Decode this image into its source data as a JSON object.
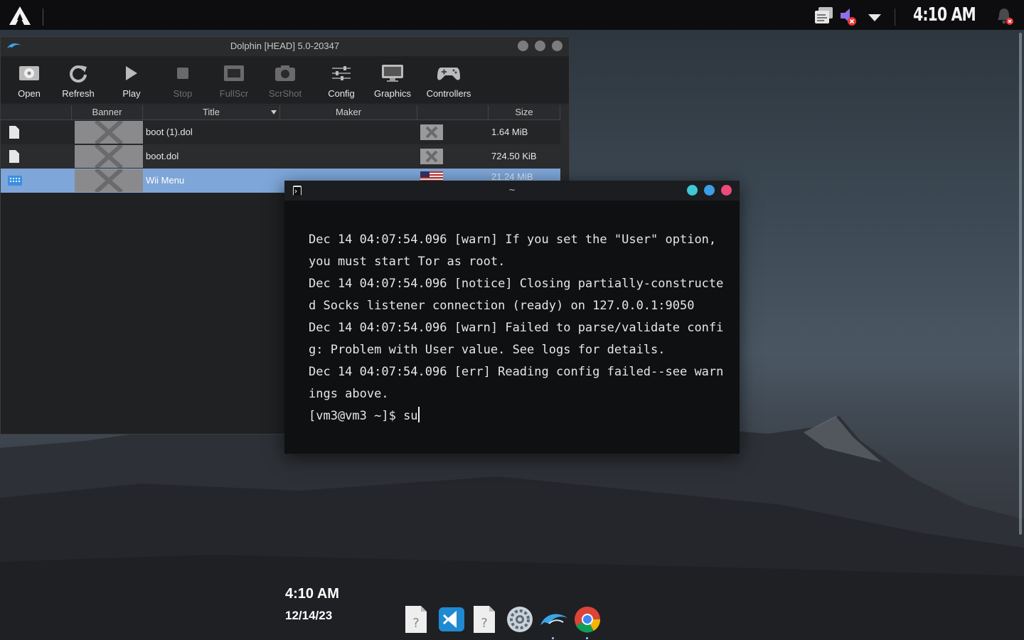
{
  "topbar": {
    "clock": "4:10 AM",
    "tray": [
      "clipboard-icon",
      "volume-muted-icon",
      "dropdown-arrow-icon",
      "notification-bell-icon"
    ]
  },
  "dolphin": {
    "title": "Dolphin [HEAD] 5.0-20347",
    "toolbar": [
      {
        "label": "Open",
        "icon": "open-icon",
        "enabled": true
      },
      {
        "label": "Refresh",
        "icon": "refresh-icon",
        "enabled": true
      },
      {
        "label": "Play",
        "icon": "play-icon",
        "enabled": true
      },
      {
        "label": "Stop",
        "icon": "stop-icon",
        "enabled": false
      },
      {
        "label": "FullScr",
        "icon": "fullscreen-icon",
        "enabled": false
      },
      {
        "label": "ScrShot",
        "icon": "camera-icon",
        "enabled": false
      },
      {
        "label": "Config",
        "icon": "config-icon",
        "enabled": true
      },
      {
        "label": "Graphics",
        "icon": "monitor-icon",
        "enabled": true
      },
      {
        "label": "Controllers",
        "icon": "gamepad-icon",
        "enabled": true
      }
    ],
    "columns": [
      "Banner",
      "Title",
      "Maker",
      "Size"
    ],
    "games": [
      {
        "title": "boot (1).dol",
        "size": "1.64 MiB",
        "selected": false
      },
      {
        "title": "boot.dol",
        "size": "724.50 KiB",
        "selected": false
      },
      {
        "title": "Wii Menu",
        "size": "21.24 MiB",
        "selected": true
      }
    ]
  },
  "terminal": {
    "title": "~",
    "lines": [
      "Dec 14 04:07:54.096 [warn] If you set the \"User\" option,",
      "you must start Tor as root.",
      "Dec 14 04:07:54.096 [notice] Closing partially-constructe",
      "d Socks listener connection (ready) on 127.0.0.1:9050",
      "Dec 14 04:07:54.096 [warn] Failed to parse/validate confi",
      "g: Problem with User value. See logs for details.",
      "Dec 14 04:07:54.096 [err] Reading config failed--see warn",
      "ings above."
    ],
    "prompt": "[vm3@vm3 ~]$ ",
    "input": "su"
  },
  "desktop": {
    "time": "4:10 AM",
    "date": "12/14/23"
  },
  "dock": [
    "unknown-file-icon",
    "vscode-icon",
    "unknown-file-icon",
    "settings-gear-icon",
    "dolphin-emulator-icon",
    "chrome-icon"
  ],
  "colors": {
    "selection": "#7ea6d8",
    "term_dot_teal": "#3fc7d6",
    "term_dot_blue": "#3b9ee6",
    "term_dot_pink": "#ee4b7b"
  }
}
